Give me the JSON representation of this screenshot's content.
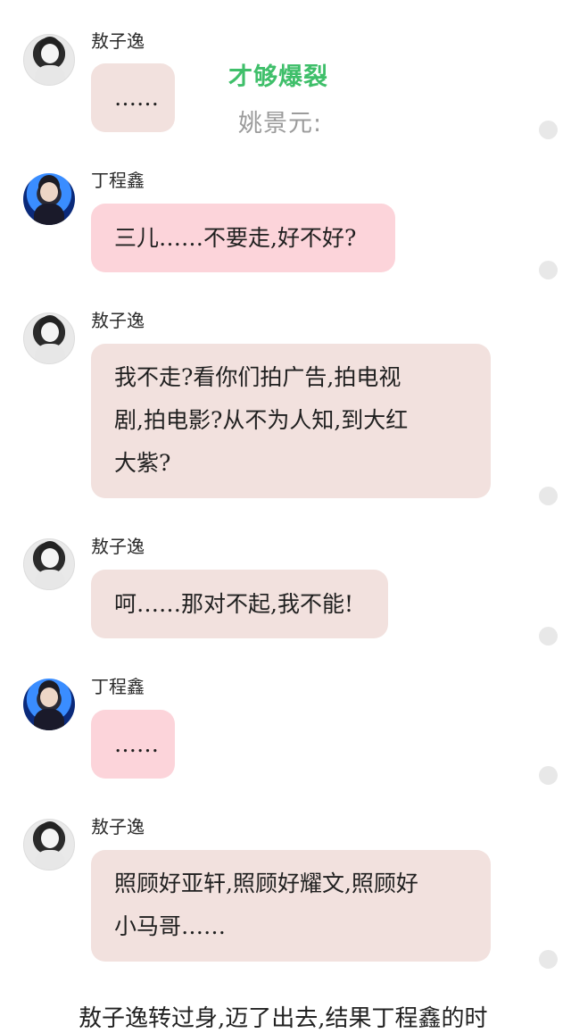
{
  "overlay": {
    "line1": "才够爆裂",
    "line2": "姚景元:"
  },
  "messages": [
    {
      "sender": "敖子逸",
      "text": "……"
    },
    {
      "sender": "丁程鑫",
      "text": "三儿……不要走,好不好?"
    },
    {
      "sender": "敖子逸",
      "text_lines": [
        "我不走?看你们拍广告,拍电视",
        "剧,拍电影?从不为人知,到大红",
        "大紫?"
      ]
    },
    {
      "sender": "敖子逸",
      "text": "呵……那对不起,我不能!"
    },
    {
      "sender": "丁程鑫",
      "text": "……"
    },
    {
      "sender": "敖子逸",
      "text_lines": [
        "照顾好亚轩,照顾好耀文,照顾好",
        "小马哥……"
      ]
    }
  ],
  "footer": {
    "text": "敖子逸转过身,迈了出去,结果丁程鑫的时"
  },
  "colors": {
    "bubble_beige": "#f2e1de",
    "bubble_pink": "#fcd4da",
    "overlay_green": "#3fbf6a"
  }
}
